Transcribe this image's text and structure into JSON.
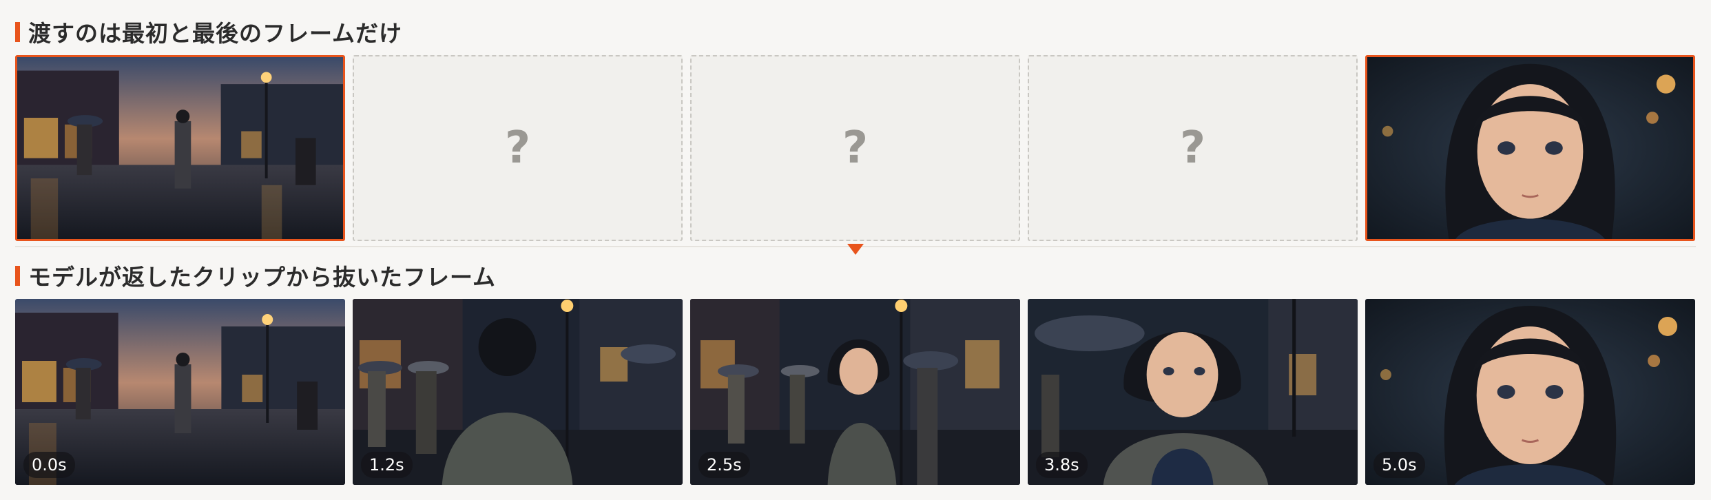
{
  "sections": {
    "top_title": "渡すのは最初と最後のフレームだけ",
    "bottom_title": "モデルが返したクリップから抜いたフレーム"
  },
  "input_frames": [
    {
      "kind": "first",
      "image": "rainy-street-wide"
    },
    {
      "kind": "unknown",
      "placeholder": "?"
    },
    {
      "kind": "unknown",
      "placeholder": "?"
    },
    {
      "kind": "unknown",
      "placeholder": "?"
    },
    {
      "kind": "last",
      "image": "girl-closeup"
    }
  ],
  "output_frames": [
    {
      "time": "0.0s",
      "image": "rainy-street-wide"
    },
    {
      "time": "1.2s",
      "image": "girl-back-view"
    },
    {
      "time": "2.5s",
      "image": "girl-turning"
    },
    {
      "time": "3.8s",
      "image": "girl-medium"
    },
    {
      "time": "5.0s",
      "image": "girl-closeup"
    }
  ],
  "colors": {
    "accent": "#e8541c",
    "background": "#f7f6f4",
    "placeholder_bg": "#f1f0ed"
  }
}
